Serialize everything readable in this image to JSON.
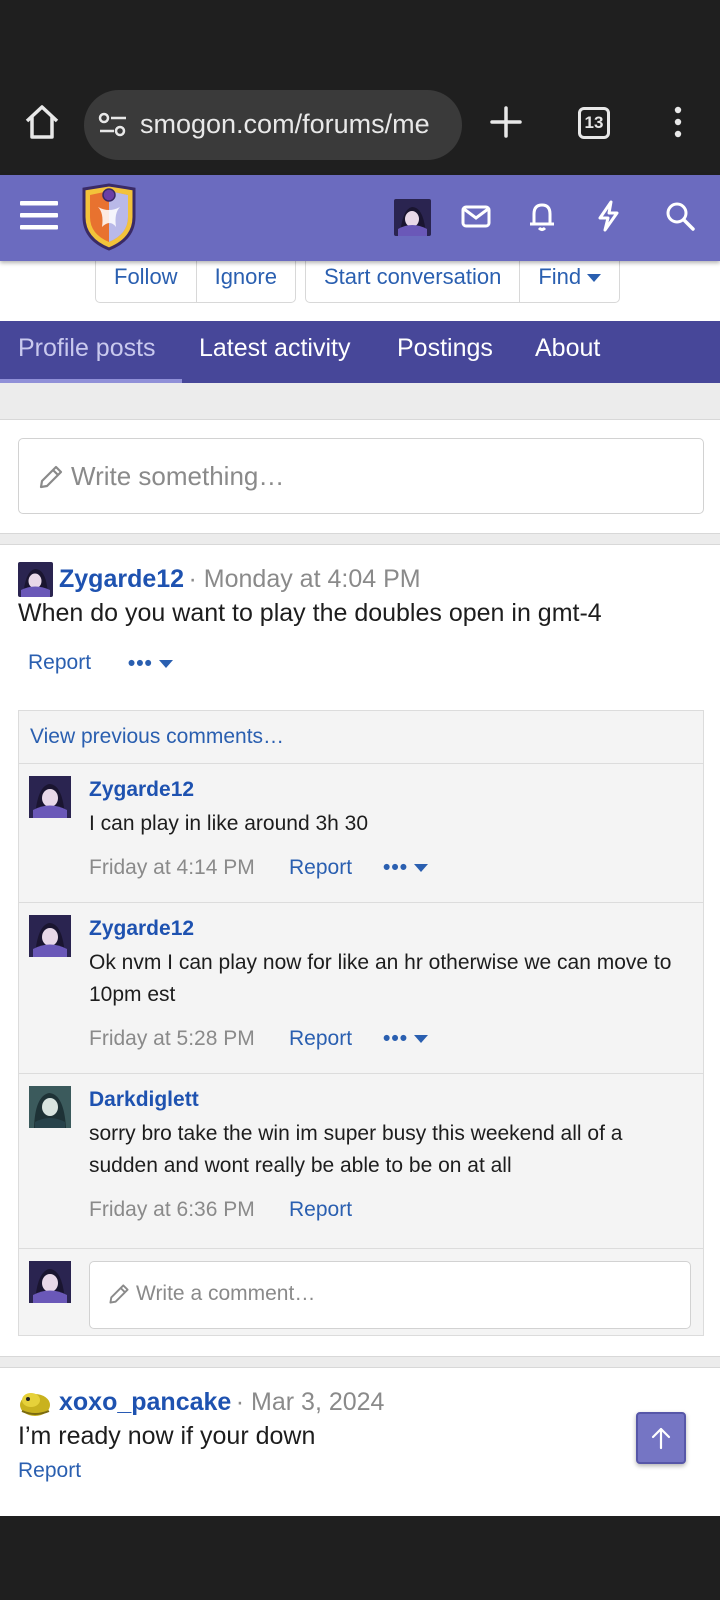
{
  "browser": {
    "url": "smogon.com/forums/me",
    "tab_count": "13"
  },
  "member_actions": {
    "follow": "Follow",
    "ignore": "Ignore",
    "start_conversation": "Start conversation",
    "find": "Find"
  },
  "tabs": [
    {
      "label": "Profile posts",
      "active": true
    },
    {
      "label": "Latest activity",
      "active": false
    },
    {
      "label": "Postings",
      "active": false
    },
    {
      "label": "About",
      "active": false
    }
  ],
  "write_placeholder": "Write something…",
  "posts": [
    {
      "user": "Zygarde12",
      "meta": "· Monday at 4:04 PM",
      "body": "When do you want to play the doubles open in gmt-4",
      "report": "Report",
      "more": "•••"
    },
    {
      "user": "xoxo_pancake",
      "meta": "· Mar 3, 2024",
      "body": "I’m ready now if your down",
      "report": "Report"
    }
  ],
  "comments_block": {
    "view_previous": "View previous comments…",
    "comments": [
      {
        "user": "Zygarde12",
        "text": "I can play in like around 3h 30",
        "time": "Friday at 4:14 PM",
        "report": "Report",
        "more": "•••"
      },
      {
        "user": "Zygarde12",
        "text": "Ok nvm I can play now for like an hr otherwise we can move to 10pm est",
        "time": "Friday at 5:28 PM",
        "report": "Report",
        "more": "•••"
      },
      {
        "user": "Darkdiglett",
        "text": "sorry bro take the win im super busy this weekend all of a sudden and wont really be able to be on at all",
        "time": "Friday at 6:36 PM",
        "report": "Report"
      }
    ],
    "reply_placeholder": "Write a comment…"
  },
  "colors": {
    "header": "#6b6bbf",
    "tab_bar": "#474799",
    "link": "#2a5fb0"
  }
}
